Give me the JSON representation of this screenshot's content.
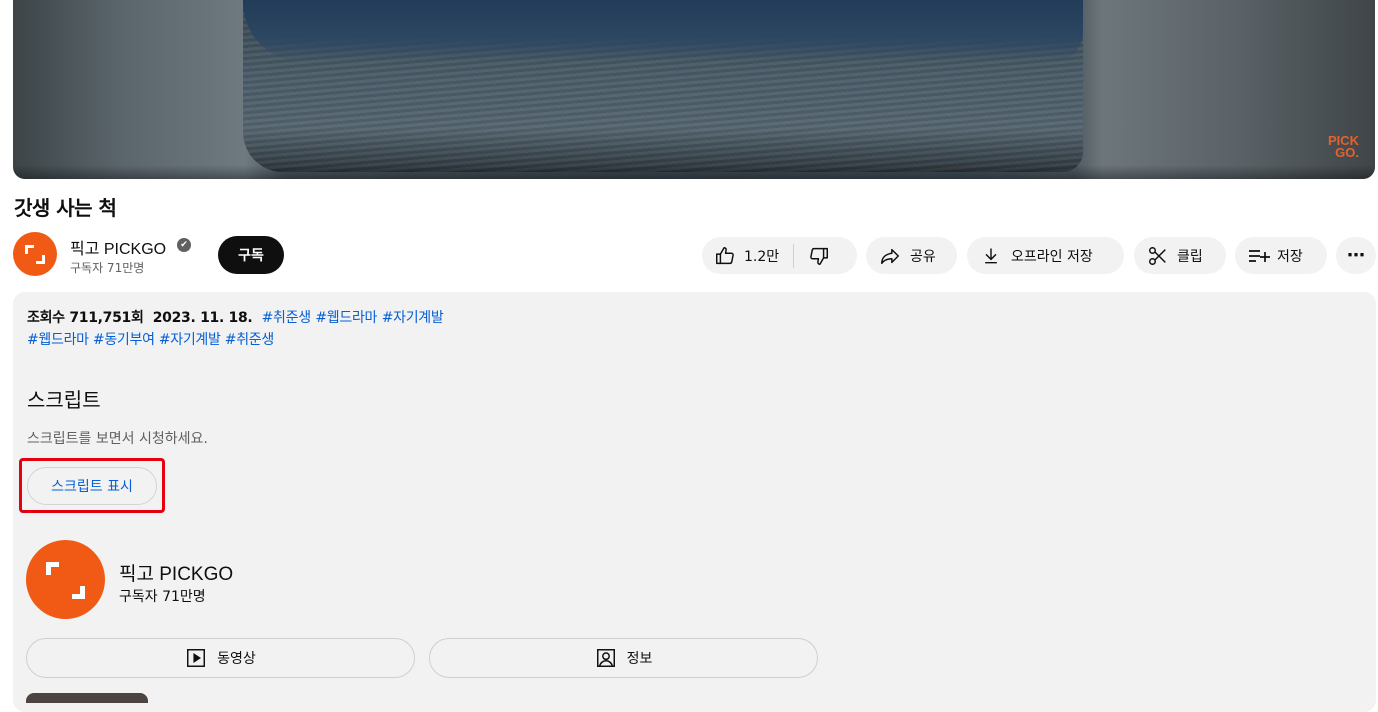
{
  "video": {
    "watermark_line1": "PICK",
    "watermark_line2": "GO."
  },
  "title": "갓생 사는 척",
  "channel": {
    "name": "픽고 PICKGO",
    "verified": "✔",
    "subscribers": "구독자 71만명",
    "subscribe_label": "구독"
  },
  "actions": {
    "likes": "1.2만",
    "share": "공유",
    "offline_save": "오프라인 저장",
    "clip": "클립",
    "save": "저장",
    "more": "⋯"
  },
  "description": {
    "views": "조회수 711,751회",
    "date": "2023. 11. 18.",
    "hashtags_line1": [
      "#취준생",
      "#웹드라마",
      "#자기계발"
    ],
    "hashtags_line2": [
      "#웹드라마",
      "#동기부여",
      "#자기계발",
      "#취준생"
    ]
  },
  "script": {
    "heading": "스크립트",
    "subtext": "스크립트를 보면서 시청하세요.",
    "button": "스크립트 표시"
  },
  "channel_card": {
    "name": "픽고 PICKGO",
    "subscribers": "구독자 71만명",
    "videos_label": "동영상",
    "about_label": "정보"
  },
  "colors": {
    "brand": "#f05a14",
    "link": "#065fd4",
    "highlight": "#e5000f"
  }
}
